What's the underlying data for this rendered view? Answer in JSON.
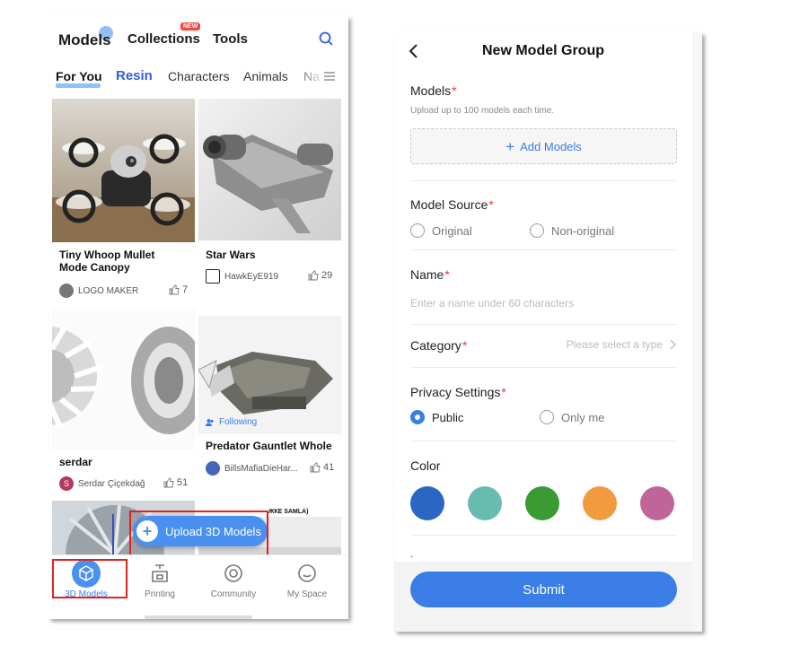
{
  "left_screen": {
    "top_nav": {
      "models": "Models",
      "collections": "Collections",
      "new_badge": "NEW",
      "tools": "Tools"
    },
    "categories": [
      "For You",
      "Resin",
      "Characters",
      "Animals",
      "Na"
    ],
    "cards": [
      {
        "title_line1": "Tiny Whoop Mullet",
        "title_line2": "Mode Canopy",
        "author": "LOGO MAKER",
        "likes": "7"
      },
      {
        "title_line1": "Star Wars",
        "title_line2": "",
        "author": "HawkEyE919",
        "likes": "29"
      },
      {
        "title_line1": "serdar",
        "title_line2": "",
        "author": "Serdar Çiçekdağ",
        "likes": "51",
        "avatar_letter": "S"
      },
      {
        "following": "Following",
        "title_line1": "Predator Gauntlet Whole",
        "title_line2": "",
        "author": "BillsMafiaDieHar...",
        "likes": "41"
      }
    ],
    "partial_card_caption": "ЖКE SAMLA)",
    "upload_button": "Upload 3D Models",
    "tabbar": [
      "3D Models",
      "Printing",
      "Community",
      "My Space"
    ]
  },
  "right_screen": {
    "title": "New Model Group",
    "models_label": "Models",
    "models_hint": "Upload up to 100 models each time.",
    "add_models": "Add Models",
    "source_label": "Model Source",
    "source_options": [
      "Original",
      "Non-original"
    ],
    "name_label": "Name",
    "name_placeholder": "Enter a name under 60 characters",
    "category_label": "Category",
    "category_placeholder": "Please select a type",
    "privacy_label": "Privacy Settings",
    "privacy_options": [
      "Public",
      "Only me"
    ],
    "privacy_selected": "Public",
    "color_label": "Color",
    "colors": [
      "#2a66c4",
      "#66bcae",
      "#3a9a33",
      "#f19b3e",
      "#c0659a"
    ],
    "more": ".",
    "required_mark": "*",
    "submit": "Submit"
  },
  "accent_colors": {
    "primary": "#3a7de6",
    "highlight_box": "#e12222",
    "required": "#e23b3b"
  }
}
